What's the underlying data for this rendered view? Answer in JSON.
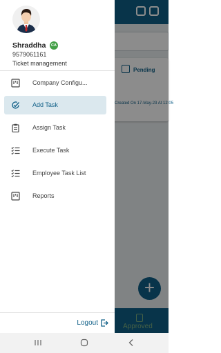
{
  "background": {
    "status_label": "Pending",
    "card_date": "Created On 17-May-23 At 12:05",
    "bottom_tab_label": "Approved",
    "fab_symbol": "+"
  },
  "profile": {
    "name": "Shraddha",
    "role_badge": "CA",
    "phone": "9579061161",
    "module": "Ticket management"
  },
  "menu": {
    "items": [
      {
        "label": "Company Configu...",
        "icon": "building-icon",
        "active": false
      },
      {
        "label": "Add Task",
        "icon": "task-check-icon",
        "active": true
      },
      {
        "label": "Assign Task",
        "icon": "clipboard-icon",
        "active": false
      },
      {
        "label": "Execute Task",
        "icon": "checklist-icon",
        "active": false
      },
      {
        "label": "Employee Task List",
        "icon": "checklist-icon",
        "active": false
      },
      {
        "label": "Reports",
        "icon": "report-icon",
        "active": false
      }
    ]
  },
  "footer": {
    "logout_label": "Logout",
    "logout_icon": "logout-icon"
  },
  "system_nav": [
    "recents-icon",
    "home-icon",
    "back-icon"
  ],
  "colors": {
    "primary": "#0f5f87",
    "active_bg": "#dbe8ee",
    "badge": "#43a047",
    "scrim": "rgba(0,0,0,0.45)"
  }
}
